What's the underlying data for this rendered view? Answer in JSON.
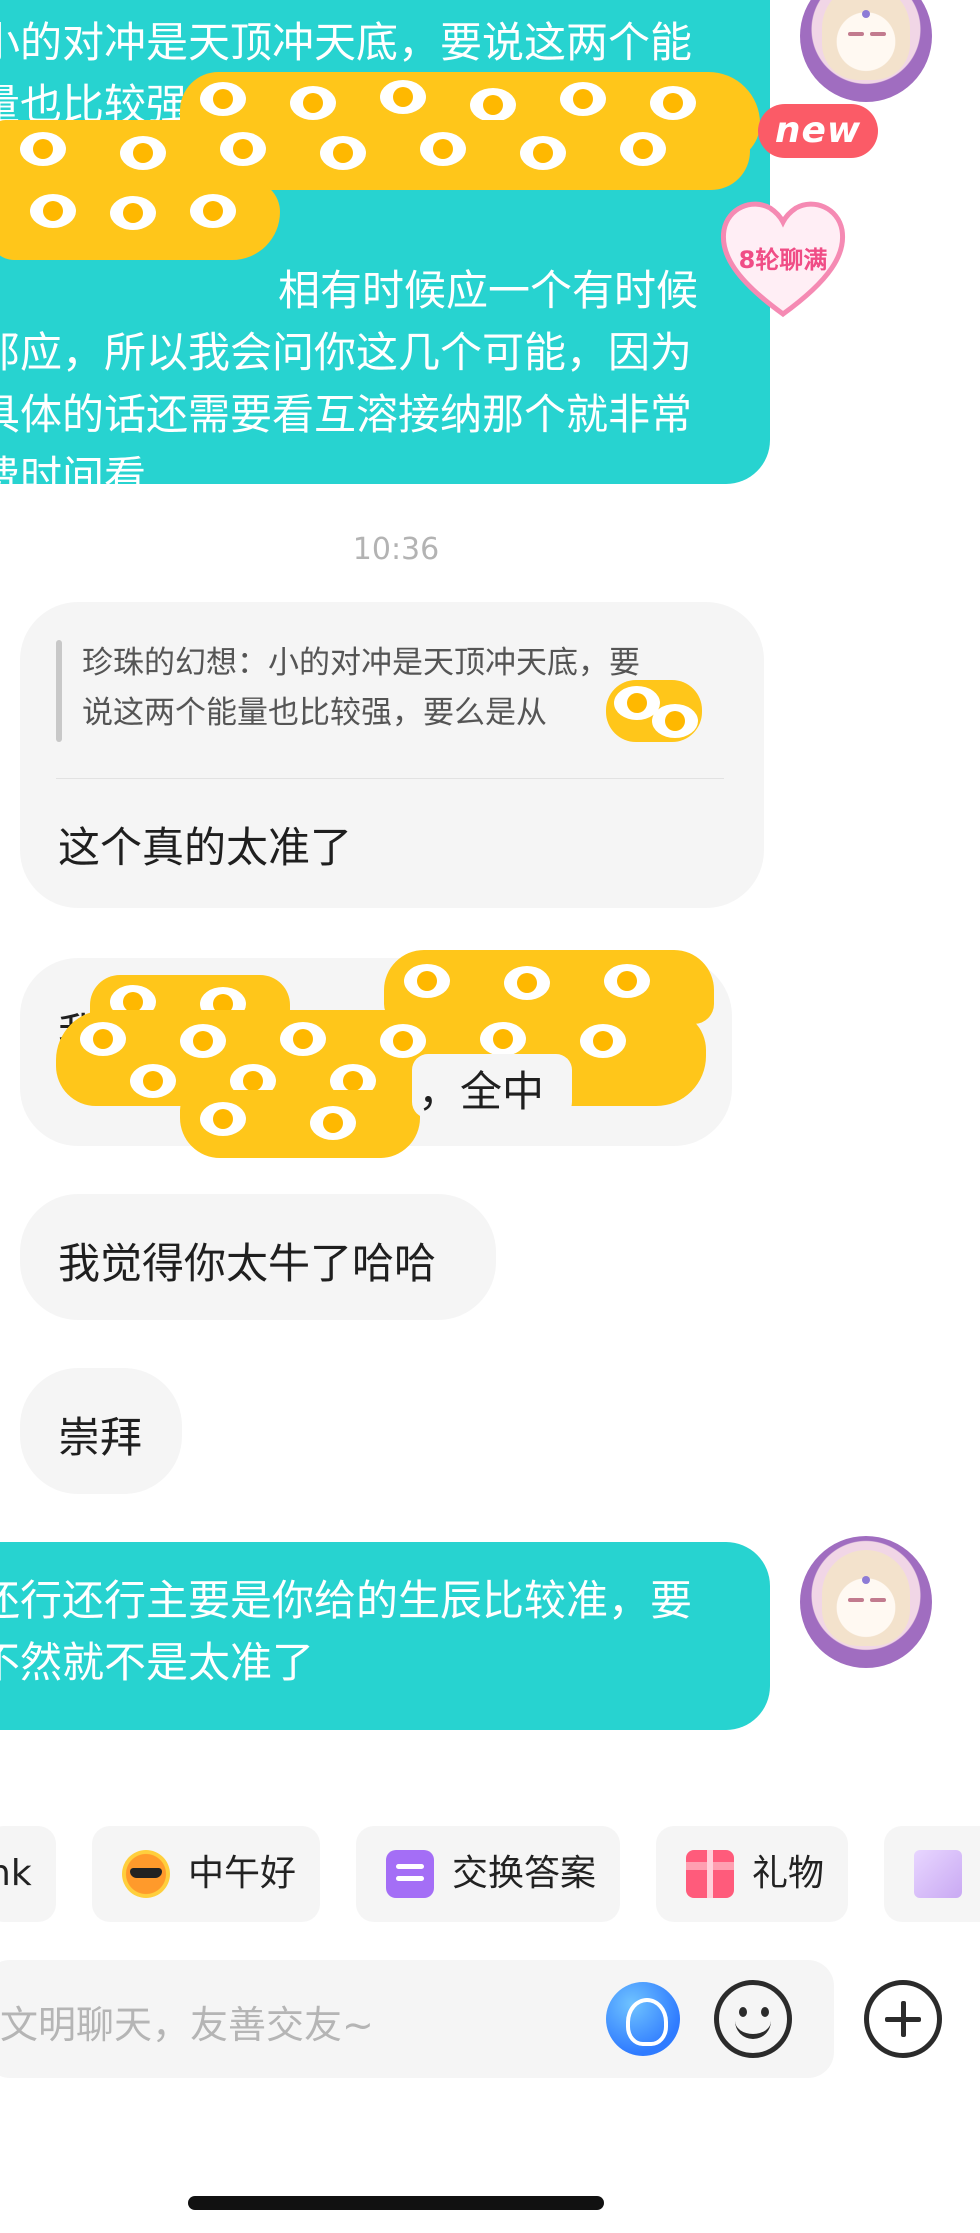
{
  "messages": {
    "sent_first": {
      "lines": [
        "小的对冲是天顶冲天底，要说这两个能",
        "量也比较强",
        "",
        "",
        "相有时候应一个有时候",
        "那应，所以我会问你这几个可能，因为",
        "具体的话还需要看互溶接纳那个就非常",
        "费时间看"
      ]
    },
    "badges": {
      "new": "new",
      "rounds": "8轮聊满"
    },
    "timestamp": "10:36",
    "quote": {
      "line1": "珍珠的幻想：小的对冲是天顶冲天底，要",
      "line2": "说这两个能量也比较强，要么是从",
      "ellipsis": "…",
      "reply": "这个真的太准了"
    },
    "received": {
      "redacted_prefix": "我",
      "redacted_suffix": "，全中",
      "msg_3": "我觉得你太牛了哈哈",
      "msg_4": "崇拜"
    },
    "sent_second": {
      "lines": [
        "还行还行主要是你给的生辰比较准，要",
        "不然就不是太准了"
      ]
    }
  },
  "chips": [
    {
      "label": "nk",
      "icon": ""
    },
    {
      "label": "中午好",
      "icon": "sun-sunglasses-icon"
    },
    {
      "label": "交换答案",
      "icon": "swap-icon"
    },
    {
      "label": "礼物",
      "icon": "gift-icon"
    },
    {
      "label": "",
      "icon": "house-icon"
    }
  ],
  "input": {
    "placeholder": "文明聊天，友善交友~"
  },
  "colors": {
    "sent_bubble": "#27d3d0",
    "received_bubble": "#f5f5f5",
    "new_badge": "#fb5b67",
    "redaction": "#ffc61a"
  }
}
